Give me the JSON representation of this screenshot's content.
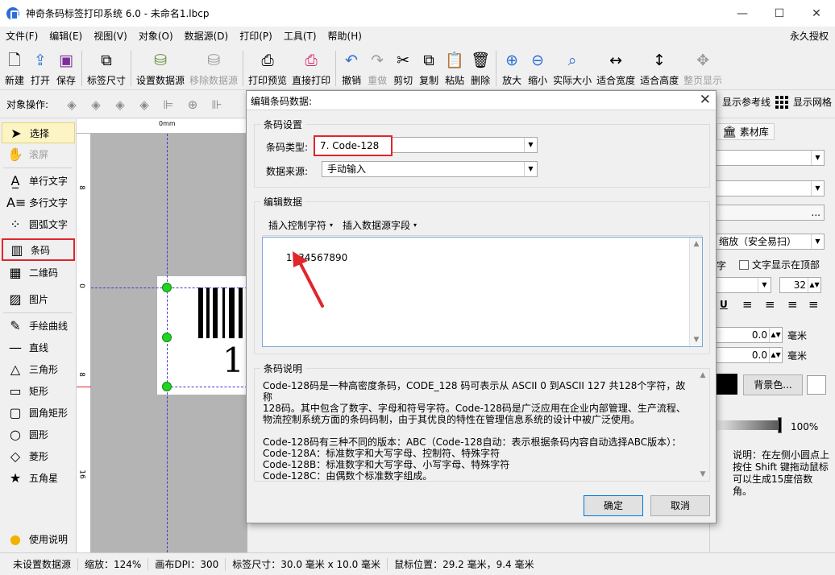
{
  "window": {
    "title": "神奇条码标签打印系统 6.0 - 未命名1.lbcp",
    "minimize": "—",
    "maximize": "☐",
    "close": "✕"
  },
  "menu": {
    "items": [
      "文件(F)",
      "编辑(E)",
      "视图(V)",
      "对象(O)",
      "数据源(D)",
      "打印(P)",
      "工具(T)",
      "帮助(H)"
    ],
    "right": "永久授权"
  },
  "toolbar": {
    "new": "新建",
    "open": "打开",
    "save": "保存",
    "label_size": "标签尺寸",
    "set_datasource": "设置数据源",
    "remove_datasource": "移除数据源",
    "print_preview": "打印预览",
    "direct_print": "直接打印",
    "undo": "撤销",
    "redo": "重做",
    "cut": "剪切",
    "copy": "复制",
    "paste": "粘贴",
    "delete": "删除",
    "zoom_in": "放大",
    "zoom_out": "缩小",
    "actual_size": "实际大小",
    "fit_width": "适合宽度",
    "fit_height": "适合高度",
    "full_page": "整页显示"
  },
  "objbar": {
    "label": "对象操作:",
    "show_guides": "显示参考线",
    "show_grid": "显示网格"
  },
  "tools": {
    "select": "选择",
    "scroll": "滚屏",
    "single_text": "单行文字",
    "multi_text": "多行文字",
    "arc_text": "圆弧文字",
    "barcode": "条码",
    "qrcode": "二维码",
    "image": "图片",
    "freehand": "手绘曲线",
    "line": "直线",
    "triangle": "三角形",
    "rect": "矩形",
    "round_rect": "圆角矩形",
    "circle": "圆形",
    "diamond": "菱形",
    "star": "五角星",
    "help": "使用说明"
  },
  "ruler": {
    "top_zero": "0mm",
    "left_marks": [
      "8",
      "0",
      "8",
      "16"
    ]
  },
  "canvas": {
    "barcode_digit": "1"
  },
  "rightpanel": {
    "library_tab": "素材库",
    "scale_option": "缩放（安全易扫）",
    "text_suffix": "字",
    "text_on_top": "文字显示在顶部",
    "font_size": "32",
    "underline": "U",
    "offset_x": "0.0",
    "offset_y": "0.0",
    "unit": "毫米",
    "bg_color_btn": "背景色...",
    "opacity": "100%",
    "hint": "说明：在左侧小圆点上按住 Shift 键拖动鼠标可以生成15度倍数角。",
    "more_btn": "..."
  },
  "status": {
    "datasource": "未设置数据源",
    "zoom": "缩放：124%",
    "dpi": "画布DPI：300",
    "label_size": "标签尺寸：30.0 毫米 x 10.0 毫米",
    "mouse_pos": "鼠标位置：29.2 毫米，9.4 毫米"
  },
  "dialog": {
    "title": "编辑条码数据:",
    "close": "✕",
    "settings_group": "条码设置",
    "type_label": "条码类型:",
    "type_value": "7.  Code-128",
    "source_label": "数据来源:",
    "source_value": "手动输入",
    "edit_group": "编辑数据",
    "insert_control": "插入控制字符",
    "insert_field": "插入数据源字段",
    "data_value": "1234567890",
    "desc_group": "条码说明",
    "desc_lines": [
      "Code-128码是一种高密度条码，CODE_128 码可表示从 ASCII 0 到ASCII 127 共128个字符，故称",
      "128码。其中包含了数字、字母和符号字符。Code-128码是广泛应用在企业内部管理、生产流程、",
      "物流控制系统方面的条码码制，由于其优良的特性在管理信息系统的设计中被广泛使用。",
      "",
      "Code-128码有三种不同的版本：ABC（Code-128自动：表示根据条码内容自动选择ABC版本）：",
      "Code-128A：标准数字和大写字母、控制符、特殊字符",
      "Code-128B：标准数字和大写字母、小写字母、特殊字符",
      "Code-128C：由偶数个标准数字组成。"
    ],
    "ok": "确定",
    "cancel": "取消"
  },
  "colors": {
    "highlight": "#e0262b",
    "handle": "#22d322",
    "guide": "#3b3bd1"
  }
}
